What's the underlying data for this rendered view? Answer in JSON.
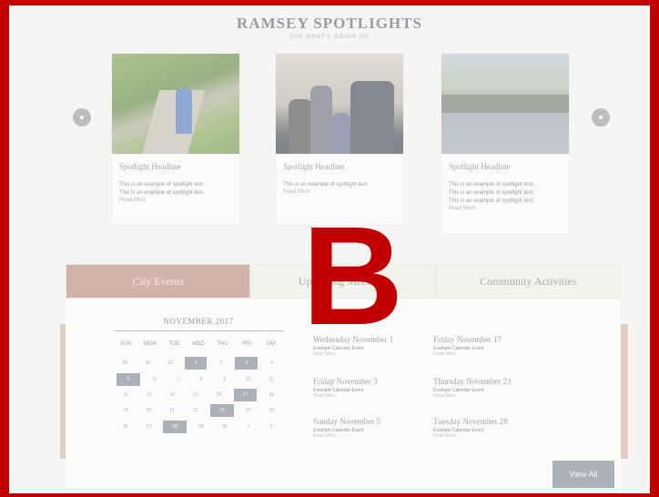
{
  "header": {
    "title": "RAMSEY SPOTLIGHTS",
    "subtitle": "SEE WHAT'S GOING ON"
  },
  "badge": {
    "letter": "B",
    "color": "#c00000"
  },
  "spotlights": [
    {
      "headline": "Spotlight Headline",
      "lines": [
        "This is an example of spotlight text.",
        "This is an example of spotlight text."
      ],
      "more": "Read More",
      "image": "boy-on-path-photo"
    },
    {
      "headline": "Spotlight Headline",
      "lines": [
        "This is an example of spotlight text."
      ],
      "more": "Read More",
      "image": "family-with-officer-photo"
    },
    {
      "headline": "Spotlight Headline",
      "lines": [
        "This is an example of spotlight text.",
        "This is an example of spotlight text.",
        "This is an example of spotlight text."
      ],
      "more": "Read More",
      "image": "park-fountain-photo"
    }
  ],
  "tabs": [
    "City Events",
    "Upcoming Meetings",
    "Community Activities"
  ],
  "calendar": {
    "month": "NOVEMBER 2017",
    "weekdays": [
      "SUN",
      "MON",
      "TUE",
      "WED",
      "THU",
      "FRI",
      "SAT"
    ],
    "weeks": [
      [
        "29",
        "30",
        "31",
        "1",
        "2",
        "3",
        "4"
      ],
      [
        "5",
        "6",
        "7",
        "8",
        "9",
        "10",
        "11"
      ],
      [
        "12",
        "13",
        "14",
        "15",
        "16",
        "17",
        "18"
      ],
      [
        "19",
        "20",
        "21",
        "22",
        "23",
        "24",
        "25"
      ],
      [
        "26",
        "27",
        "28",
        "29",
        "30",
        "1",
        "2"
      ]
    ]
  },
  "events": [
    {
      "date": "Wednesday November 1",
      "title": "Example Calendar Event",
      "more": "Read More"
    },
    {
      "date": "Friday November 17",
      "title": "Example Calendar Event",
      "more": "Read More"
    },
    {
      "date": "Friday November 3",
      "title": "Example Calendar Event",
      "more": "Read More"
    },
    {
      "date": "Thursday November 23",
      "title": "Example Calendar Event",
      "more": "Read More"
    },
    {
      "date": "Sunday November 5",
      "title": "Example Calendar Event",
      "more": "Read More"
    },
    {
      "date": "Tuesday November 28",
      "title": "Example Calendar Event",
      "more": "Read More"
    }
  ],
  "view_all": "View All",
  "colors": {
    "border": "#c00000",
    "accent": "#b47a6c",
    "slate": "#6d7888"
  }
}
